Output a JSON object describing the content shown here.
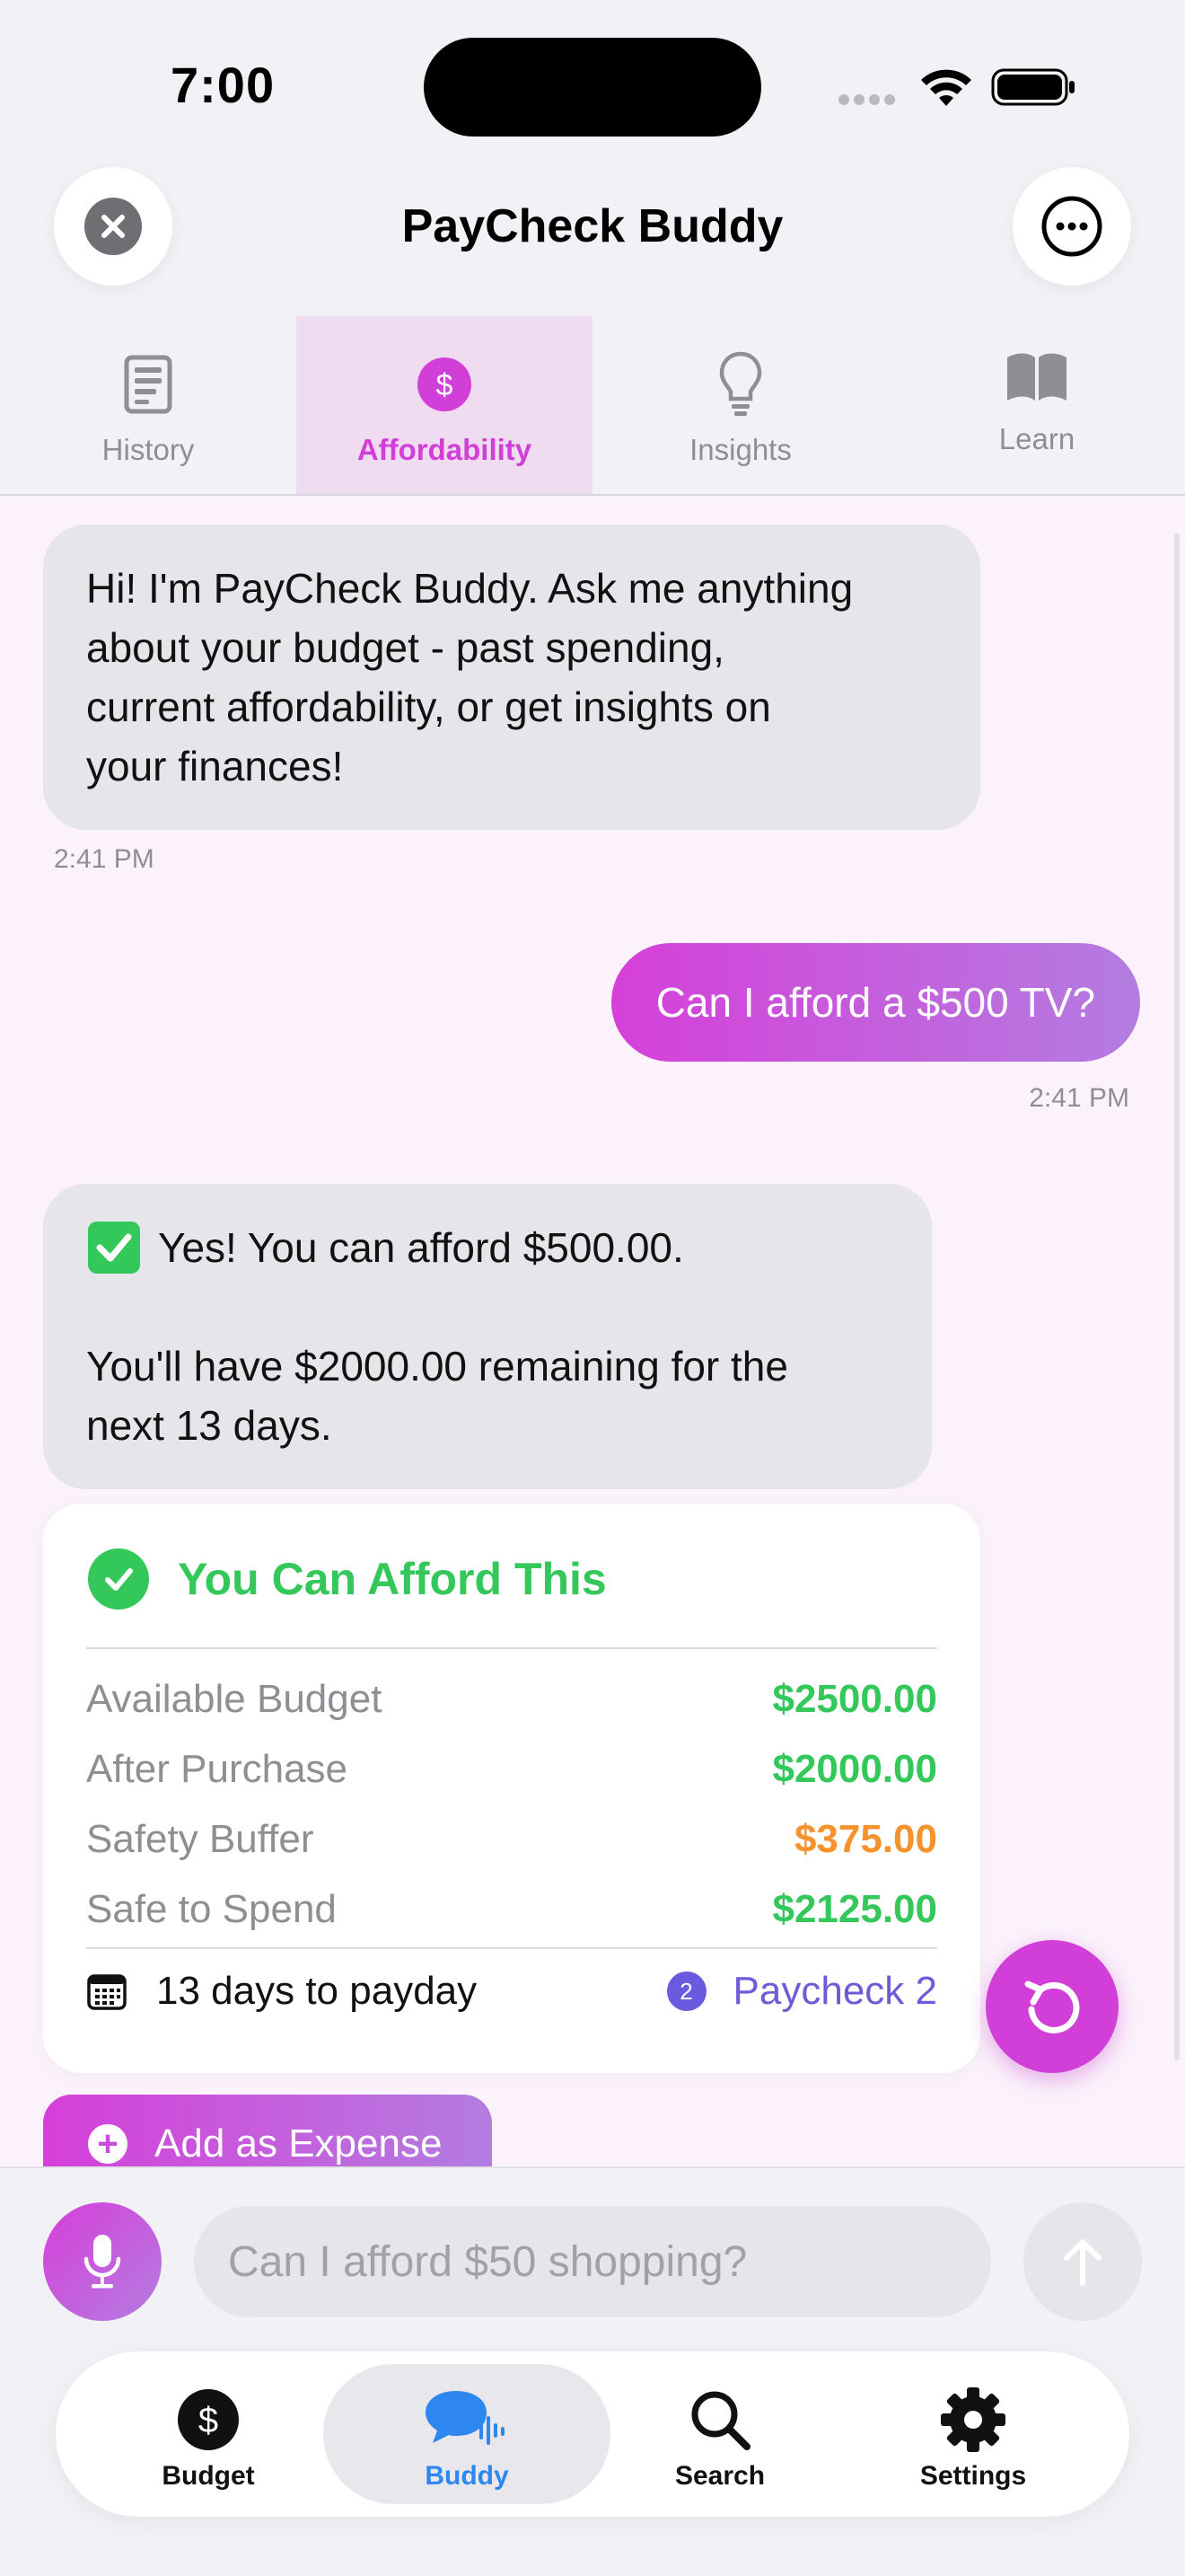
{
  "status_bar": {
    "time": "7:00"
  },
  "header": {
    "title": "PayCheck Buddy",
    "close_icon": "close-icon",
    "more_icon": "ellipsis-icon"
  },
  "tabs": [
    {
      "label": "History",
      "icon": "document-icon",
      "active": false
    },
    {
      "label": "Affordability",
      "icon": "dollar-icon",
      "active": true
    },
    {
      "label": "Insights",
      "icon": "lightbulb-icon",
      "active": false
    },
    {
      "label": "Learn",
      "icon": "book-icon",
      "active": false
    }
  ],
  "messages": [
    {
      "from": "bot",
      "lines": [
        "Hi! I'm PayCheck Buddy. Ask me anything",
        "about your budget - past spending,",
        "current affordability, or get insights on",
        "your finances!"
      ],
      "time": "2:41 PM"
    },
    {
      "from": "user",
      "text": "Can I afford a $500 TV?",
      "time": "2:41 PM"
    },
    {
      "from": "bot",
      "line1": "Yes! You can afford $500.00.",
      "line2": "You'll have $2000.00 remaining for the",
      "line3": "next 13 days."
    }
  ],
  "affordability_card": {
    "title": "You Can Afford This",
    "rows": [
      {
        "label": "Available Budget",
        "value": "$2500.00",
        "color": "#34c759"
      },
      {
        "label": "After Purchase",
        "value": "$2000.00",
        "color": "#34c759"
      },
      {
        "label": "Safety Buffer",
        "value": "$375.00",
        "color": "#f5922b"
      },
      {
        "label": "Safe to Spend",
        "value": "$2125.00",
        "color": "#34c759"
      }
    ],
    "payday_text": "13 days to payday",
    "paycheck_number": "2",
    "paycheck_label": "Paycheck 2"
  },
  "actions": {
    "add_expense_label": "Add as Expense"
  },
  "input": {
    "placeholder": "Can I afford $50 shopping?",
    "value": ""
  },
  "bottom_nav": [
    {
      "label": "Budget",
      "icon": "dollar-circle-icon",
      "active": false
    },
    {
      "label": "Buddy",
      "icon": "chat-waveform-icon",
      "active": true
    },
    {
      "label": "Search",
      "icon": "search-icon",
      "active": false
    },
    {
      "label": "Settings",
      "icon": "gear-icon",
      "active": false
    }
  ],
  "colors": {
    "accent": "#d23fd8",
    "success": "#34c759",
    "warning": "#f5922b",
    "nav_active": "#2e86f0",
    "paycheck": "#6e5bd8"
  }
}
